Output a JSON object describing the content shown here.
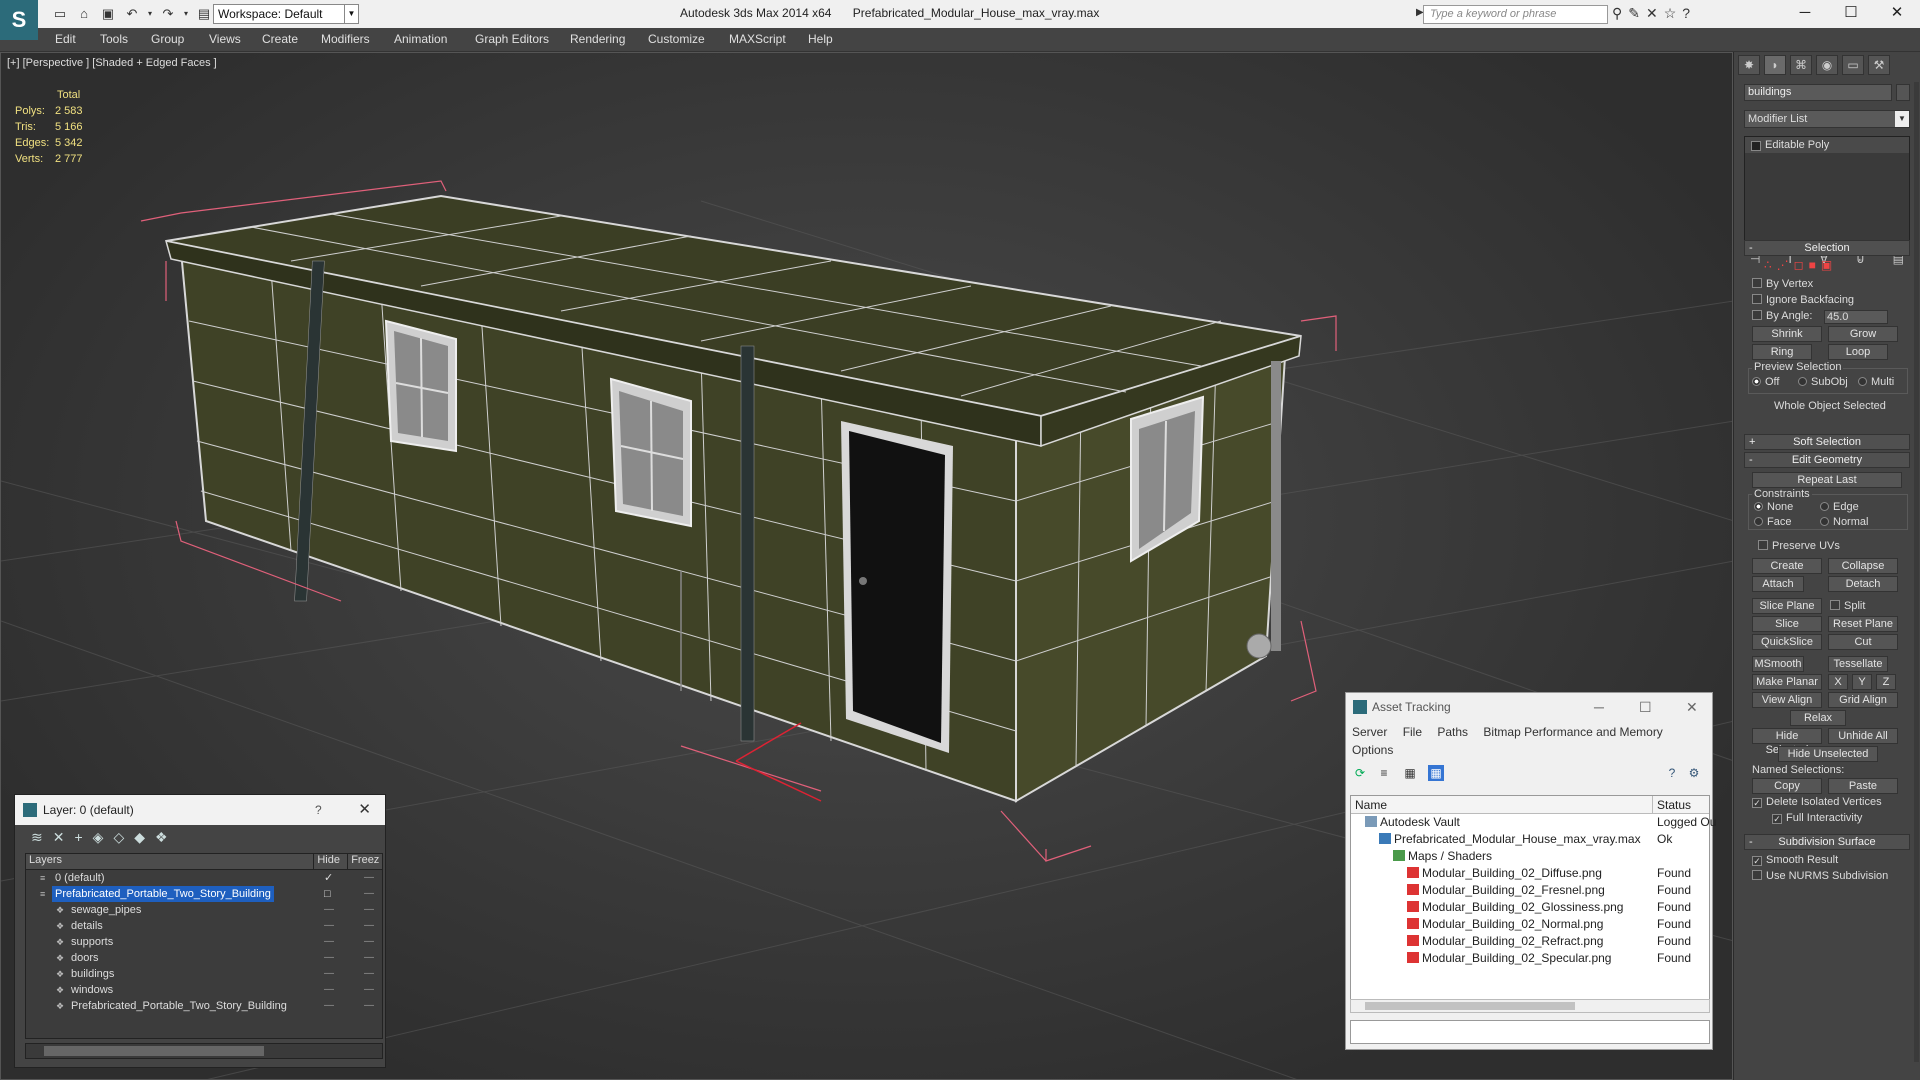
{
  "app": {
    "logo": "S",
    "title": "Autodesk 3ds Max  2014 x64",
    "filename": "Prefabricated_Modular_House_max_vray.max",
    "workspace": "Workspace: Default",
    "search_placeholder": "Type a keyword or phrase"
  },
  "menu": [
    "Edit",
    "Tools",
    "Group",
    "Views",
    "Create",
    "Modifiers",
    "Animation",
    "Graph Editors",
    "Rendering",
    "Customize",
    "MAXScript",
    "Help"
  ],
  "viewport": {
    "label": "[+] [Perspective ] [Shaded + Edged Faces ]",
    "stats": {
      "header": "Total",
      "rows": [
        {
          "k": "Polys:",
          "v": "2 583"
        },
        {
          "k": "Tris:",
          "v": "5 166"
        },
        {
          "k": "Edges:",
          "v": "5 342"
        },
        {
          "k": "Verts:",
          "v": "2 777"
        }
      ]
    }
  },
  "layer_panel": {
    "title": "Layer: 0 (default)",
    "help": "?",
    "columns": {
      "layers": "Layers",
      "hide": "Hide",
      "freeze": "Freez"
    },
    "rows": [
      {
        "name": "0 (default)",
        "indent": 1,
        "selected": false,
        "check": "✓"
      },
      {
        "name": "Prefabricated_Portable_Two_Story_Building",
        "indent": 1,
        "selected": true,
        "check": "□"
      },
      {
        "name": "sewage_pipes",
        "indent": 2,
        "selected": false,
        "check": ""
      },
      {
        "name": "details",
        "indent": 2,
        "selected": false,
        "check": ""
      },
      {
        "name": "supports",
        "indent": 2,
        "selected": false,
        "check": ""
      },
      {
        "name": "doors",
        "indent": 2,
        "selected": false,
        "check": ""
      },
      {
        "name": "buildings",
        "indent": 2,
        "selected": false,
        "check": ""
      },
      {
        "name": "windows",
        "indent": 2,
        "selected": false,
        "check": ""
      },
      {
        "name": "Prefabricated_Portable_Two_Story_Building",
        "indent": 2,
        "selected": false,
        "check": ""
      }
    ]
  },
  "asset_panel": {
    "title": "Asset Tracking",
    "menu": [
      "Server",
      "File",
      "Paths",
      "Bitmap Performance and Memory",
      "Options"
    ],
    "columns": {
      "name": "Name",
      "status": "Status"
    },
    "rows": [
      {
        "name": "Autodesk Vault",
        "status": "Logged Ou",
        "level": 0,
        "icon": "vault-icon"
      },
      {
        "name": "Prefabricated_Modular_House_max_vray.max",
        "status": "Ok",
        "level": 1,
        "icon": "max-file-icon"
      },
      {
        "name": "Maps / Shaders",
        "status": "",
        "level": 2,
        "icon": "maps-folder-icon"
      },
      {
        "name": "Modular_Building_02_Diffuse.png",
        "status": "Found",
        "level": 3,
        "icon": "png-file-icon"
      },
      {
        "name": "Modular_Building_02_Fresnel.png",
        "status": "Found",
        "level": 3,
        "icon": "png-file-icon"
      },
      {
        "name": "Modular_Building_02_Glossiness.png",
        "status": "Found",
        "level": 3,
        "icon": "png-file-icon"
      },
      {
        "name": "Modular_Building_02_Normal.png",
        "status": "Found",
        "level": 3,
        "icon": "png-file-icon"
      },
      {
        "name": "Modular_Building_02_Refract.png",
        "status": "Found",
        "level": 3,
        "icon": "png-file-icon"
      },
      {
        "name": "Modular_Building_02_Specular.png",
        "status": "Found",
        "level": 3,
        "icon": "png-file-icon"
      }
    ]
  },
  "command_panel": {
    "object_name": "buildings",
    "modifier_list": "Modifier List",
    "stack": [
      "Editable Poly"
    ],
    "selection": {
      "title": "Selection",
      "by_vertex": "By Vertex",
      "ignore_backfacing": "Ignore Backfacing",
      "by_angle": "By Angle:",
      "angle_value": "45.0",
      "shrink": "Shrink",
      "grow": "Grow",
      "ring": "Ring",
      "loop": "Loop",
      "preview_selection": "Preview Selection",
      "preview_off": "Off",
      "preview_subobj": "SubObj",
      "preview_multi": "Multi",
      "whole_object": "Whole Object Selected"
    },
    "soft_selection": "Soft Selection",
    "edit_geometry": {
      "title": "Edit Geometry",
      "repeat_last": "Repeat Last",
      "constraints": "Constraints",
      "none": "None",
      "edge": "Edge",
      "face": "Face",
      "normal": "Normal",
      "preserve_uvs": "Preserve UVs",
      "create": "Create",
      "collapse": "Collapse",
      "attach": "Attach",
      "detach": "Detach",
      "slice_plane": "Slice Plane",
      "split": "Split",
      "slice": "Slice",
      "reset_plane": "Reset Plane",
      "quickslice": "QuickSlice",
      "cut": "Cut",
      "msmooth": "MSmooth",
      "tessellate": "Tessellate",
      "make_planar": "Make Planar",
      "x": "X",
      "y": "Y",
      "z": "Z",
      "view_align": "View Align",
      "grid_align": "Grid Align",
      "relax": "Relax",
      "hide_selected": "Hide Selected",
      "unhide_all": "Unhide All",
      "hide_unselected": "Hide Unselected",
      "named_selections": "Named Selections:",
      "copy": "Copy",
      "paste": "Paste",
      "delete_isolated": "Delete Isolated Vertices",
      "full_interactivity": "Full Interactivity"
    },
    "subdivision": {
      "title": "Subdivision Surface",
      "smooth_result": "Smooth Result",
      "use_nurms": "Use NURMS Subdivision"
    }
  },
  "colors": {
    "wall": "#3f4226",
    "wire": "#d8d8d8",
    "bbox": "#e0607a",
    "selection": "#1e5fbf"
  }
}
